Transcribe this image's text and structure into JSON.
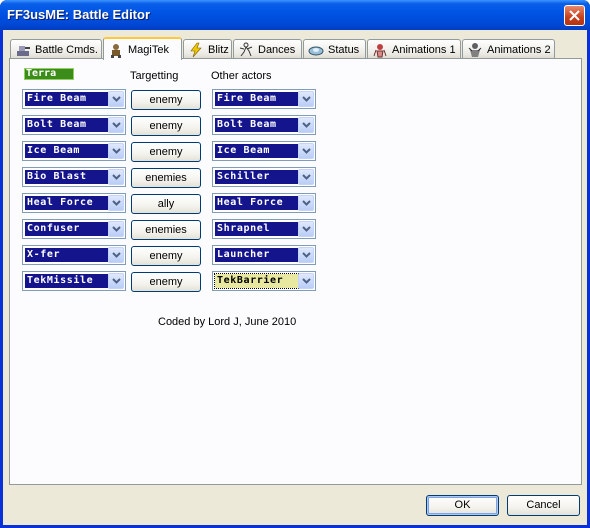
{
  "window": {
    "title": "FF3usME: Battle Editor"
  },
  "tabs": [
    {
      "label": "Battle Cmds.",
      "icon": "battle-cmds-icon"
    },
    {
      "label": "MagiTek",
      "icon": "magitek-icon"
    },
    {
      "label": "Blitz",
      "icon": "lightning-icon"
    },
    {
      "label": "Dances",
      "icon": "dances-icon"
    },
    {
      "label": "Status",
      "icon": "status-icon"
    },
    {
      "label": "Animations 1",
      "icon": "animations1-icon"
    },
    {
      "label": "Animations 2",
      "icon": "animations2-icon"
    }
  ],
  "active_tab": "MagiTek",
  "magitek": {
    "character": "Terra",
    "headers": {
      "targetting": "Targetting",
      "other_actors": "Other actors"
    },
    "rows": [
      {
        "terra_attack": "Fire Beam",
        "target": "enemy",
        "other": "Fire Beam"
      },
      {
        "terra_attack": "Bolt Beam",
        "target": "enemy",
        "other": "Bolt Beam"
      },
      {
        "terra_attack": "Ice Beam",
        "target": "enemy",
        "other": "Ice Beam"
      },
      {
        "terra_attack": "Bio Blast",
        "target": "enemies",
        "other": "Schiller"
      },
      {
        "terra_attack": "Heal Force",
        "target": "ally",
        "other": "Heal Force"
      },
      {
        "terra_attack": "Confuser",
        "target": "enemies",
        "other": "Shrapnel"
      },
      {
        "terra_attack": "X-fer",
        "target": "enemy",
        "other": "Launcher"
      },
      {
        "terra_attack": "TekMissile",
        "target": "enemy",
        "other": "TekBarrier"
      }
    ],
    "credit": "Coded by Lord J, June 2010"
  },
  "buttons": {
    "ok": "OK",
    "cancel": "Cancel"
  },
  "colors": {
    "titlebar": "#0055e5",
    "attack_bg": "#14148c",
    "character_label_bg": "#3c8c1c",
    "face": "#ece9d8"
  }
}
